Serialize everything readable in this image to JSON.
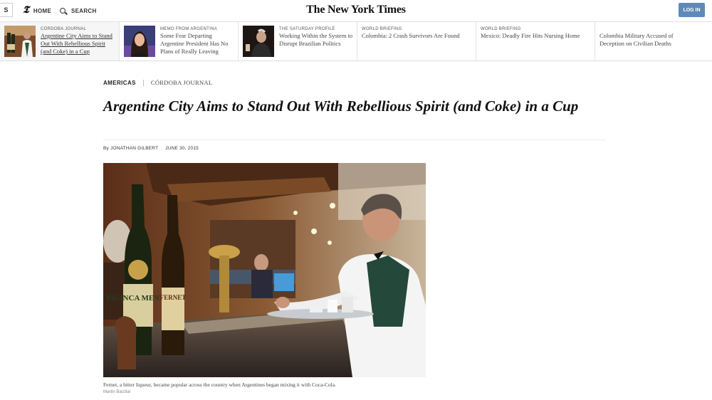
{
  "nav": {
    "sections_label": "S",
    "home_label": "HOME",
    "search_label": "SEARCH",
    "home_icon": "t-logo-icon",
    "search_icon": "search-icon",
    "masthead": "The New York Times",
    "login_label": "LOG IN"
  },
  "ribbon": [
    {
      "kicker": "CÓRDOBA JOURNAL",
      "headline": "Argentine City Aims to Stand Out With Rebellious Spirit (and Coke) in a Cup"
    },
    {
      "kicker": "MEMO FROM ARGENTINA",
      "headline": "Some Fear Departing Argentine President Has No Plans of Really Leaving"
    },
    {
      "kicker": "THE SATURDAY PROFILE",
      "headline": "Working Within the System to Disrupt Brazilian Politics"
    },
    {
      "kicker": "WORLD BRIEFING",
      "headline": "Colombia: 2 Crash Survivors Are Found"
    },
    {
      "kicker": "WORLD BRIEFING",
      "headline": "Mexico: Deadly Fire Hits Nursing Home"
    },
    {
      "kicker": "",
      "headline": "Colombia Military Accused of Deception on Civilian Deaths"
    }
  ],
  "article": {
    "section": "AMERICAS",
    "subsection": "CÓRDOBA JOURNAL",
    "headline": "Argentine City Aims to Stand Out With Rebellious Spirit (and Coke) in a Cup",
    "byline": "By JONATHAN GILBERT",
    "date": "JUNE 30, 2015",
    "photo_caption": "Fernet, a bitter liqueur, became popular across the country when Argentines began mixing it with Coca-Cola.",
    "photo_credit": "Martin Barzilai",
    "bottle_label_1": "BRANCA MENTA",
    "bottle_label_2": "FERNET"
  },
  "colors": {
    "login": "#5f89b8",
    "text": "#111111"
  }
}
